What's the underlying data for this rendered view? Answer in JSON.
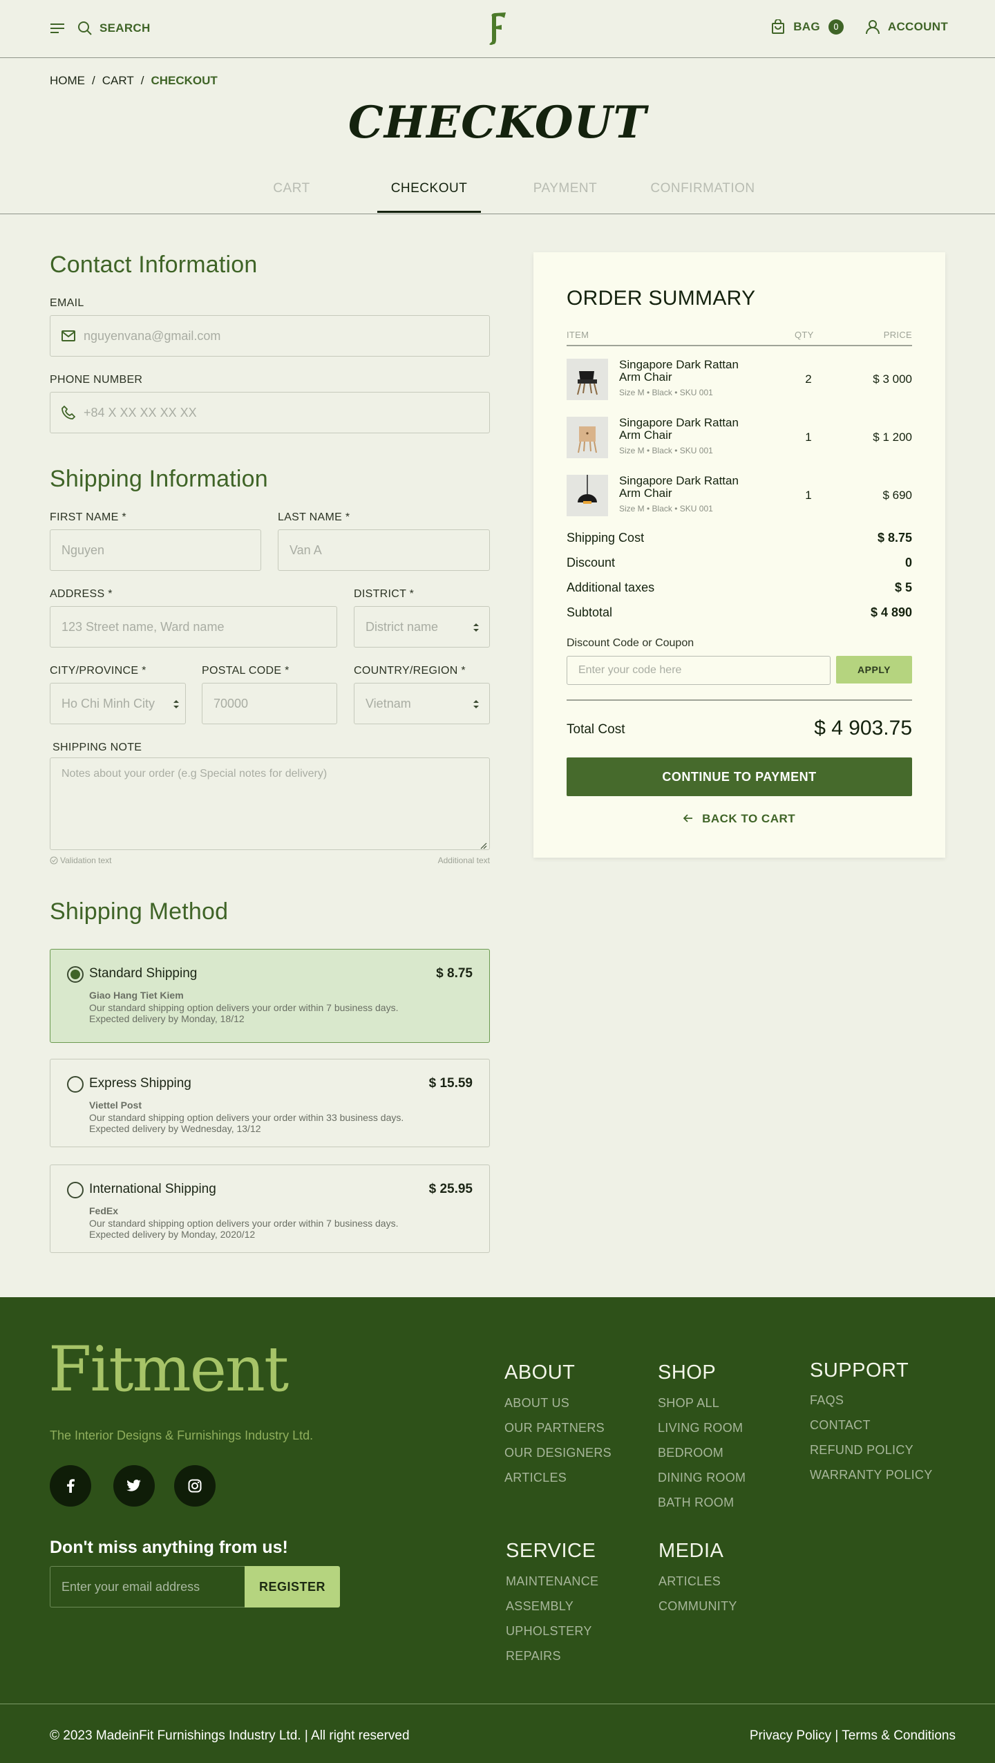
{
  "header": {
    "search_label": "SEARCH",
    "bag_label": "BAG",
    "bag_count": "0",
    "account_label": "ACCOUNT"
  },
  "breadcrumb": {
    "home": "HOME",
    "sep1": "/",
    "cart": "CART",
    "sep2": "/",
    "current": "CHECKOUT"
  },
  "page_title": "CHECKOUT",
  "steps": [
    "CART",
    "CHECKOUT",
    "PAYMENT",
    "CONFIRMATION"
  ],
  "contact": {
    "title": "Contact Information",
    "email_label": "EMAIL",
    "email_placeholder": "nguyenvana@gmail.com",
    "phone_label": "PHONE NUMBER",
    "phone_placeholder": "+84 X XX XX XX XX"
  },
  "shipping": {
    "title": "Shipping Information",
    "first_name_label": "FIRST NAME *",
    "first_name_placeholder": "Nguyen",
    "last_name_label": "LAST NAME *",
    "last_name_placeholder": "Van A",
    "address_label": "ADDRESS *",
    "address_placeholder": "123 Street name, Ward name",
    "district_label": "DISTRICT *",
    "district_value": "District name",
    "city_label": "CITY/PROVINCE *",
    "city_value": "Ho Chi Minh City",
    "postal_label": "POSTAL CODE *",
    "postal_placeholder": "70000",
    "country_label": "COUNTRY/REGION *",
    "country_value": "Vietnam",
    "note_label": "SHIPPING NOTE",
    "note_placeholder": "Notes about your order (e.g Special notes for delivery)",
    "validation_text": "Validation text",
    "additional_text": "Additional text"
  },
  "shipping_method": {
    "title": "Shipping Method",
    "options": [
      {
        "name": "Standard Shipping",
        "price": "$ 8.75",
        "carrier": "Giao Hang Tiet Kiem",
        "desc": "Our standard shipping option delivers your order within 7 business days.",
        "eta": "Expected delivery by Monday, 18/12"
      },
      {
        "name": "Express Shipping",
        "price": "$ 15.59",
        "carrier": "Viettel Post",
        "desc": "Our standard shipping option delivers your order within 33 business days.",
        "eta": "Expected delivery by Wednesday, 13/12"
      },
      {
        "name": "International Shipping",
        "price": "$ 25.95",
        "carrier": "FedEx",
        "desc": "Our standard shipping option delivers your order within 7 business days.",
        "eta": "Expected delivery by Monday, 2020/12"
      }
    ]
  },
  "summary": {
    "title": "ORDER SUMMARY",
    "col_item": "ITEM",
    "col_qty": "QTY",
    "col_price": "PRICE",
    "items": [
      {
        "name": "Singapore Dark Rattan Arm Chair",
        "meta": "Size M  •  Black  •  SKU 001",
        "qty": "2",
        "price": "$ 3 000"
      },
      {
        "name": "Singapore Dark Rattan Arm Chair",
        "meta": "Size M  •  Black  •  SKU 001",
        "qty": "1",
        "price": "$ 1 200"
      },
      {
        "name": "Singapore Dark Rattan Arm Chair",
        "meta": "Size M  •  Black  •  SKU 001",
        "qty": "1",
        "price": "$ 690"
      }
    ],
    "shipping_cost_label": "Shipping Cost",
    "shipping_cost": "$ 8.75",
    "discount_label": "Discount",
    "discount": "0",
    "taxes_label": "Additional taxes",
    "taxes": "$ 5",
    "subtotal_label": "Subtotal",
    "subtotal": "$ 4 890",
    "coupon_label": "Discount Code or Coupon",
    "coupon_placeholder": "Enter your code here",
    "apply_label": "APPLY",
    "total_label": "Total Cost",
    "total": "$ 4 903.75",
    "continue_label": "CONTINUE TO PAYMENT",
    "back_label": "BACK TO CART"
  },
  "footer": {
    "brand": "Fitment",
    "tagline": "The Interior Designs & Furnishings Industry Ltd.",
    "newsletter_title": "Don't miss anything from us!",
    "email_placeholder": "Enter your email address",
    "register_label": "REGISTER",
    "about": {
      "title": "ABOUT",
      "links": [
        "ABOUT US",
        "OUR PARTNERS",
        "OUR DESIGNERS",
        "ARTICLES"
      ]
    },
    "shop": {
      "title": "SHOP",
      "links": [
        "SHOP ALL",
        "LIVING ROOM",
        "BEDROOM",
        "DINING ROOM",
        "BATH ROOM"
      ]
    },
    "support": {
      "title": "SUPPORT",
      "links": [
        "FAQS",
        "CONTACT",
        "REFUND POLICY",
        "WARRANTY POLICY"
      ]
    },
    "service": {
      "title": "SERVICE",
      "links": [
        "MAINTENANCE",
        "ASSEMBLY",
        "UPHOLSTERY",
        "REPAIRS"
      ]
    },
    "media": {
      "title": "MEDIA",
      "links": [
        "ARTICLES",
        "COMMUNITY"
      ]
    },
    "copyright": "© 2023 MadeinFit Furnishings Industry Ltd.  | All right reserved",
    "legal": "Privacy Policy | Terms & Conditions"
  },
  "colors": {
    "brand_green": "#3f6427",
    "accent_lime": "#b5d47f",
    "footer_bg": "#2e5119"
  }
}
